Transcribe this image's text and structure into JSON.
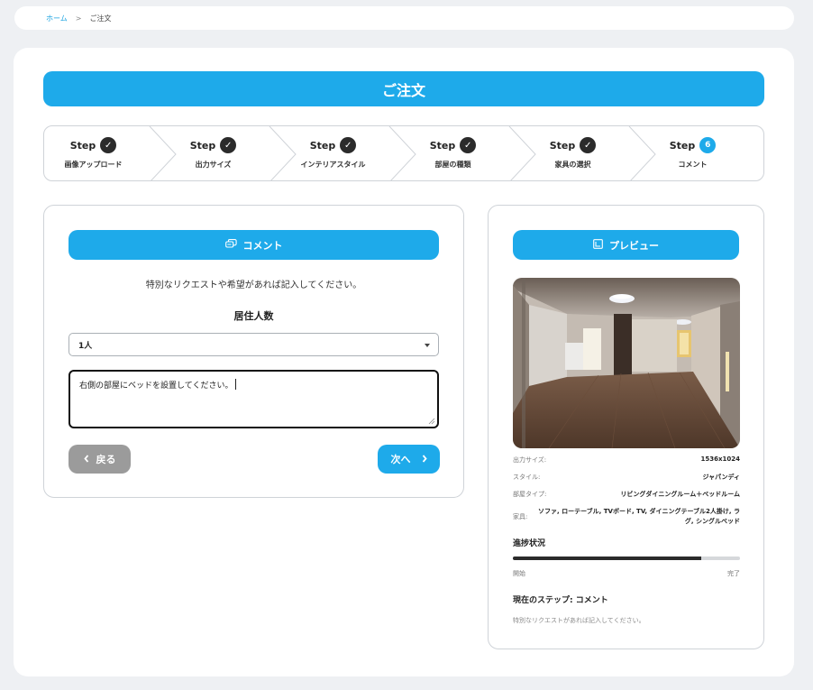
{
  "breadcrumb": {
    "home": "ホーム",
    "separator": ">",
    "current": "ご注文"
  },
  "title": "ご注文",
  "steps": [
    {
      "step": "Step",
      "status": "done",
      "badge": "✓",
      "label": "画像アップロード"
    },
    {
      "step": "Step",
      "status": "done",
      "badge": "✓",
      "label": "出力サイズ"
    },
    {
      "step": "Step",
      "status": "done",
      "badge": "✓",
      "label": "インテリアスタイル"
    },
    {
      "step": "Step",
      "status": "done",
      "badge": "✓",
      "label": "部屋の種類"
    },
    {
      "step": "Step",
      "status": "done",
      "badge": "✓",
      "label": "家具の選択"
    },
    {
      "step": "Step",
      "status": "current",
      "badge": "6",
      "label": "コメント"
    }
  ],
  "comment": {
    "header": "コメント",
    "intro": "特別なリクエストや希望があれば記入してください。",
    "residents_label": "居住人数",
    "residents_value": "1人",
    "textarea_value": "右側の部屋にベッドを設置してください。",
    "back_label": "戻る",
    "next_label": "次へ"
  },
  "preview": {
    "header": "プレビュー",
    "info": [
      {
        "key": "出力サイズ:",
        "value": "1536x1024"
      },
      {
        "key": "スタイル:",
        "value": "ジャパンディ"
      },
      {
        "key": "部屋タイプ:",
        "value": "リビングダイニングルーム＋ベッドルーム"
      },
      {
        "key": "家具:",
        "value": "ソファ, ローテーブル, TVボード, TV, ダイニングテーブル2人掛け, ラグ, シングルベッド"
      }
    ],
    "progress_title": "進捗状況",
    "progress": 0.83,
    "progress_start": "開始",
    "progress_end": "完了",
    "current_step": "現在のステップ: コメント",
    "current_desc": "特別なリクエストがあれば記入してください。"
  },
  "colors": {
    "accent": "#1eaaea",
    "done": "#2b2b2b",
    "back_button": "#9b9b9b",
    "background": "#eef0f3"
  },
  "icons": {
    "steps_done": "check-icon",
    "comment": "chat-bubble-icon",
    "preview": "image-frame-icon",
    "back": "chevron-left-icon",
    "next": "chevron-right-icon",
    "select": "caret-down-icon"
  }
}
